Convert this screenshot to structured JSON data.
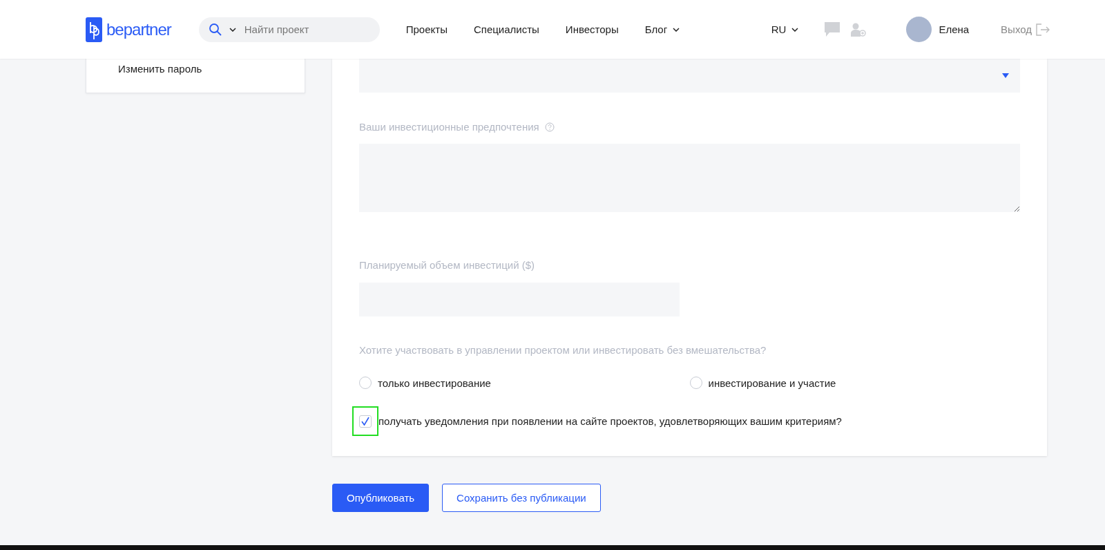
{
  "header": {
    "logo": "bepartner",
    "search": {
      "placeholder": "Найти проект"
    },
    "nav": [
      {
        "label": "Проекты",
        "dropdown": false
      },
      {
        "label": "Специалисты",
        "dropdown": false
      },
      {
        "label": "Инвесторы",
        "dropdown": false
      },
      {
        "label": "Блог",
        "dropdown": true
      }
    ],
    "language": "RU",
    "user": {
      "name": "Елена"
    },
    "logout": "Выход"
  },
  "sidebar": {
    "items": [
      {
        "label": "Изменить пароль"
      }
    ]
  },
  "form": {
    "preferences_label": "Ваши инвестиционные предпочтения",
    "amount_label": "Планируемый объем инвестиций ($)",
    "participation_question": "Хотите участвовать в управлении проектом или инвестировать без вмешательства?",
    "options": [
      {
        "label": "только инвестирование",
        "selected": false
      },
      {
        "label": "инвестирование и участие",
        "selected": false
      }
    ],
    "notify": {
      "label": "получать уведомления при появлении на сайте проектов, удовлетворяющих вашим критериям?",
      "checked": true,
      "highlighted": true
    }
  },
  "buttons": [
    {
      "label": "Опубликовать",
      "kind": "primary"
    },
    {
      "label": "Сохранить без публикации",
      "kind": "secondary"
    }
  ]
}
